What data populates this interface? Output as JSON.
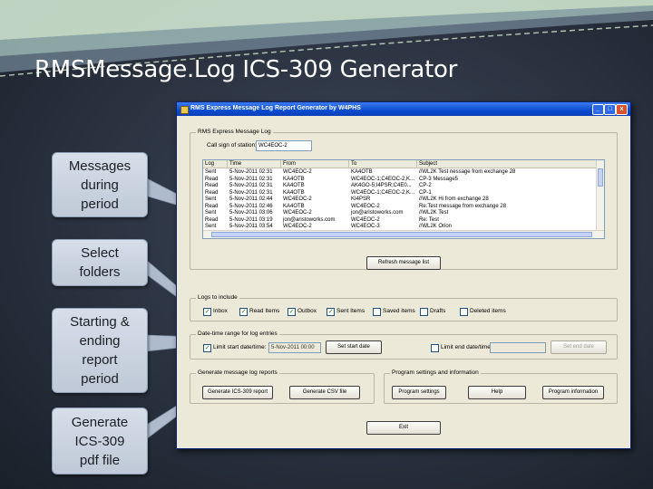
{
  "slide": {
    "title": "RMSMessage.Log ICS-309 Generator",
    "callouts": [
      "Messages\nduring\nperiod",
      "Select\nfolders",
      "Starting &\nending\nreport\nperiod",
      "Generate\nICS-309\npdf file"
    ]
  },
  "window": {
    "title": "RMS Express Message Log Report Generator by W4PHS",
    "controls": [
      "_",
      "□",
      "x"
    ],
    "message_log": {
      "group_label": "RMS Express Message Log",
      "call_sign_label": "Call sign of station:",
      "call_sign_value": "WC4EOC-2",
      "columns": [
        "Log",
        "Time",
        "From",
        "To",
        "Subject"
      ],
      "rows": [
        [
          "Sent",
          "5-Nov-2011 02:31",
          "WC4EOC-2",
          "KA4OTB",
          "//WL2K Test nessage from exchange 28"
        ],
        [
          "Read",
          "5-Nov-2011 02:31",
          "KA4OTB",
          "WC4EOC-1;C4EOC-2,K...",
          "CP-3 Message5"
        ],
        [
          "Read",
          "5-Nov-2011 02:31",
          "KA4OTB",
          "AK4GO-5;I4PSR;C4E0...",
          "CP-2"
        ],
        [
          "Read",
          "5-Nov-2011 02:31",
          "KA4OTB",
          "WC4EOC-1;C4EOC-2,K...",
          "CP-1"
        ],
        [
          "Sent",
          "5-Nov-2011 02:44",
          "WC4EOC-2",
          "KI4PSR",
          "//WL2K Hi from exchange 28"
        ],
        [
          "Read",
          "5-Nov-2011 02:46",
          "KA4OTB",
          "WC4EOC-2",
          "Re:Test message from exchange 28"
        ],
        [
          "Sent",
          "5-Nov-2011 03:06",
          "WC4EOC-2",
          "jon@aristoworks.com",
          "//WL2K Test"
        ],
        [
          "Read",
          "5-Nov-2011 03:19",
          "jon@aristoworks.com",
          "WC4EOC-2",
          "Re: Test"
        ],
        [
          "Sent",
          "5-Nov-2011 03:54",
          "WC4EOC-2",
          "WC4EOC-3",
          "//WL2K Orion"
        ]
      ],
      "refresh_button": "Refresh message list"
    },
    "logs_to_include": {
      "group_label": "Logs to include",
      "items": [
        {
          "label": "Inbox",
          "checked": true
        },
        {
          "label": "Read Items",
          "checked": true
        },
        {
          "label": "Outbox",
          "checked": true
        },
        {
          "label": "Sent Items",
          "checked": true
        },
        {
          "label": "Saved items",
          "checked": false
        },
        {
          "label": "Drafts",
          "checked": false
        },
        {
          "label": "Deleted items",
          "checked": false
        }
      ]
    },
    "date_range": {
      "group_label": "Date-time range for log entries",
      "limit_start_label": "Limit start date/time:",
      "start_value": "5-Nov-2011 00:00",
      "set_start_button": "Set start date",
      "limit_end_label": "Limit end date/time:",
      "set_end_button": "Set end date"
    },
    "generate": {
      "group_label": "Generate message log reports",
      "ics_button": "Generate ICS-309 report",
      "csv_button": "Generate CSV file"
    },
    "program": {
      "group_label": "Program settings and information",
      "settings_button": "Program settings",
      "help_button": "Help",
      "info_button": "Program information"
    },
    "exit_button": "Exit"
  },
  "colors": {
    "titlebar": "#0a4bd0",
    "window_bg": "#ece9d8",
    "callout_bg": "#d0d8e4",
    "slide_bg": "#2a3240"
  }
}
